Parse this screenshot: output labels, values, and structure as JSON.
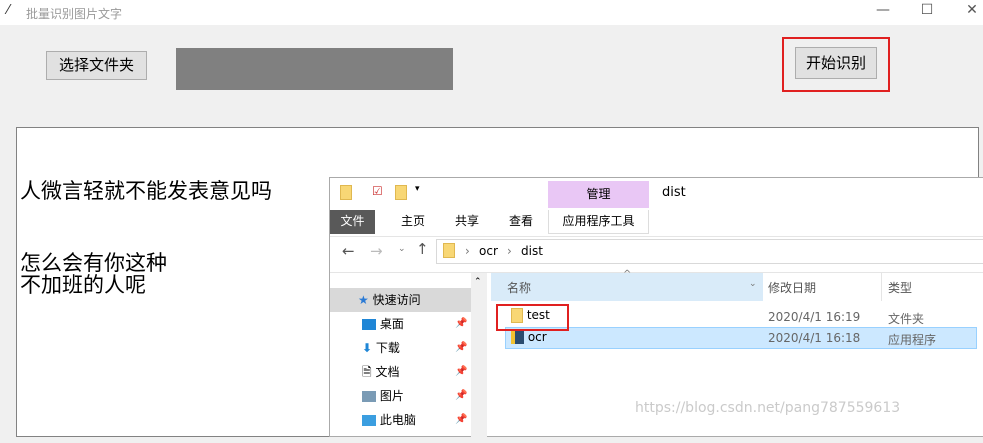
{
  "window": {
    "title": "批量识别图片文字",
    "minimize": "—",
    "maximize": "☐",
    "close": "✕"
  },
  "toolbar": {
    "select_folder": "选择文件夹",
    "start": "开始识别"
  },
  "accent": "#e02020",
  "output_lines": [
    "人微言轻就不能发表意见吗",
    "怎么会有你这种",
    "不加班的人呢"
  ],
  "explorer": {
    "title": "dist",
    "manage_tab": "管理",
    "tabs": [
      "文件",
      "主页",
      "共享",
      "查看",
      "应用程序工具"
    ],
    "path": [
      "ocr",
      "dist"
    ],
    "columns": [
      "名称",
      "修改日期",
      "类型"
    ],
    "files": [
      {
        "name": "test",
        "date": "2020/4/1 16:19",
        "type": "文件夹"
      },
      {
        "name": "ocr",
        "date": "2020/4/1 16:18",
        "type": "应用程序"
      }
    ],
    "nav": [
      "快速访问",
      "桌面",
      "下载",
      "文档",
      "图片",
      "此电脑"
    ]
  },
  "watermark": "https://blog.csdn.net/pang787559613"
}
